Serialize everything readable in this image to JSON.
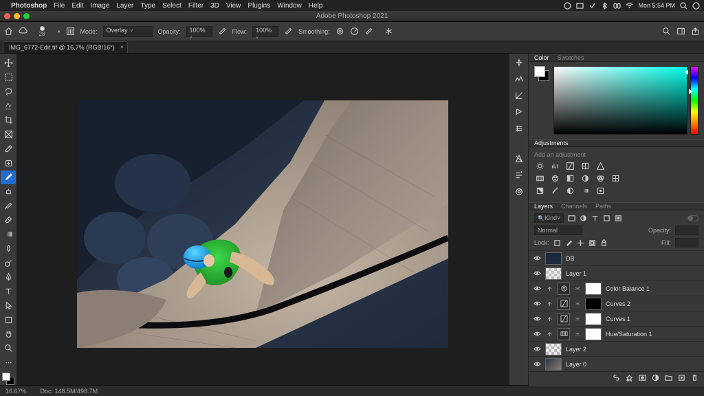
{
  "mac": {
    "app": "Photoshop",
    "menus": [
      "File",
      "Edit",
      "Image",
      "Layer",
      "Type",
      "Select",
      "Filter",
      "3D",
      "View",
      "Plugins",
      "Window",
      "Help"
    ],
    "clock": "Mon 5:54 PM"
  },
  "window": {
    "title": "Adobe Photoshop 2021"
  },
  "options": {
    "brush_size": "28",
    "mode_label": "Mode:",
    "mode_value": "Overlay",
    "opacity_label": "Opacity:",
    "opacity_value": "100%",
    "flow_label": "Flow:",
    "flow_value": "100%",
    "smoothing_label": "Smoothing:"
  },
  "document": {
    "tab_label": "IMG_6772-Edit.tif @ 16.7% (RGB/16*)"
  },
  "panels": {
    "color": {
      "tab_color": "Color",
      "tab_swatches": "Swatches",
      "hue_deg": 175
    },
    "adjustments": {
      "tab": "Adjustments",
      "hint": "Add an adjustment"
    },
    "layers": {
      "tab_layers": "Layers",
      "tab_channels": "Channels",
      "tab_paths": "Paths",
      "kind_label": "Kind",
      "blend_mode": "Normal",
      "opacity_label": "Opacity:",
      "lock_label": "Lock:",
      "fill_label": "Fill:",
      "items": [
        {
          "name": "DB",
          "type": "fill",
          "visible": true
        },
        {
          "name": "Layer 1",
          "type": "pixel",
          "visible": true
        },
        {
          "name": "Color Balance 1",
          "type": "adj",
          "visible": true,
          "masked": true
        },
        {
          "name": "Curves 2",
          "type": "adj",
          "visible": true,
          "masked": true
        },
        {
          "name": "Curves 1",
          "type": "adj",
          "visible": true,
          "masked": true
        },
        {
          "name": "Hue/Saturation 1",
          "type": "adj",
          "visible": true,
          "masked": true
        },
        {
          "name": "Layer 2",
          "type": "pixel",
          "visible": true
        },
        {
          "name": "Layer 0",
          "type": "pixel",
          "visible": true
        }
      ]
    }
  },
  "status": {
    "zoom": "16.67%",
    "doc_size": "Doc: 148.5M/498.7M"
  }
}
